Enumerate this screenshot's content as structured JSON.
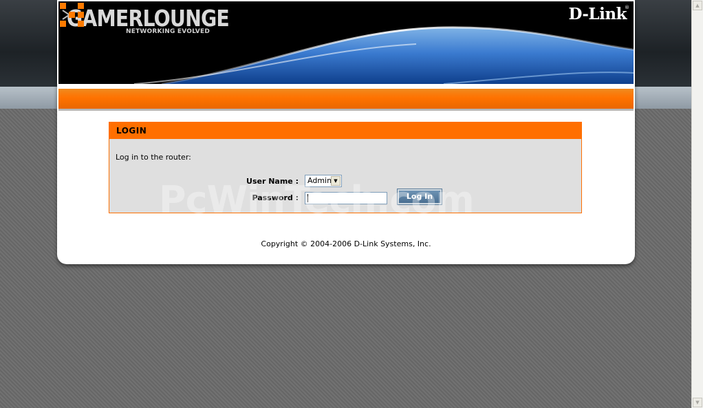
{
  "banner": {
    "brand_name": "GAMERLOUNGE",
    "brand_tagline": "NETWORKING EVOLVED",
    "vendor_logo": "D-Link",
    "vendor_reg": "®"
  },
  "login": {
    "header": "LOGIN",
    "instruction": "Log in to the router:",
    "username_label": "User Name :",
    "username_value": "Admin",
    "password_label": "Password :",
    "password_value": "",
    "button_label": "Log In"
  },
  "watermark": "PcWinTech.com",
  "footer": {
    "copyright": "Copyright © 2004-2006 D-Link Systems, Inc."
  },
  "colors": {
    "accent_orange": "#ff6f00",
    "panel_bg": "#dfdfdf",
    "button_blue": "#4a6f91"
  },
  "icons": {
    "brand_mark": "orange-square-grid-icon",
    "dropdown": "chevron-down-icon",
    "scroll_up": "scroll-up-arrow-icon",
    "scroll_down": "scroll-down-arrow-icon"
  }
}
